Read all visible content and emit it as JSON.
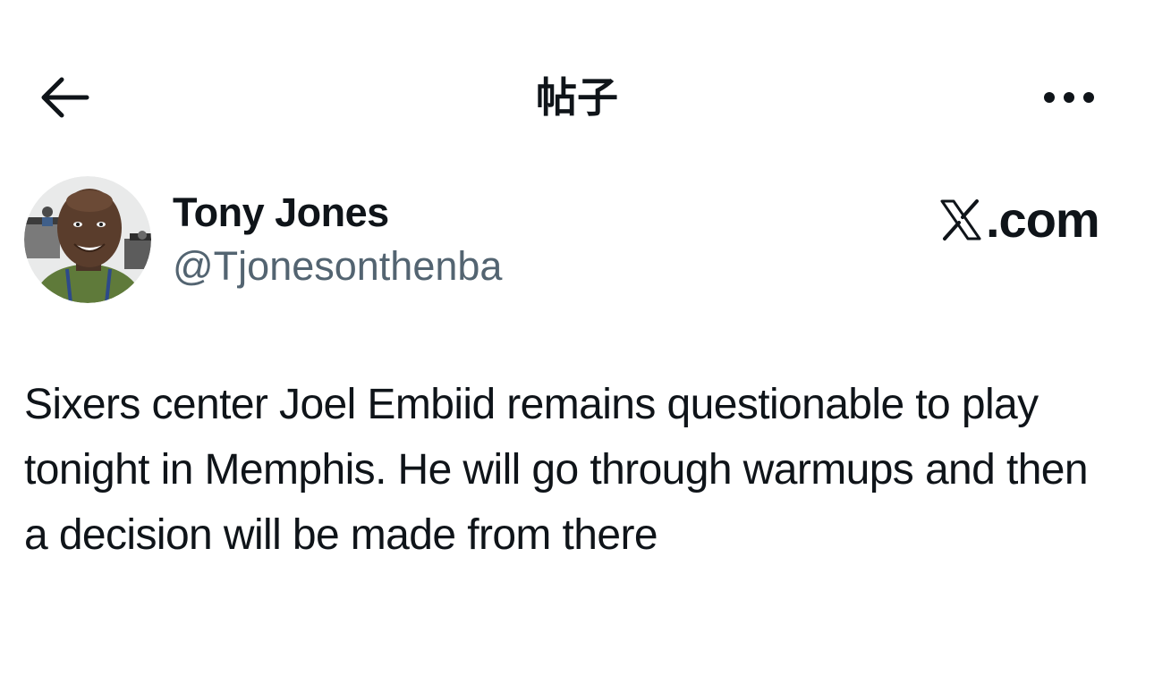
{
  "header": {
    "back_icon": "arrow-left-icon",
    "title": "帖子",
    "more_icon": "more-horizontal-icon"
  },
  "author": {
    "name": "Tony Jones",
    "handle": "@Tjonesonthenba",
    "avatar_icon": "avatar-photo"
  },
  "brand": {
    "icon": "x-logo-icon",
    "text": ".com"
  },
  "tweet": {
    "text": "Sixers center Joel Embiid remains questionable to play tonight in Memphis. He will go through warmups and then a decision will be made from there"
  },
  "colors": {
    "text": "#0f1419",
    "secondary": "#536471",
    "background": "#ffffff"
  }
}
